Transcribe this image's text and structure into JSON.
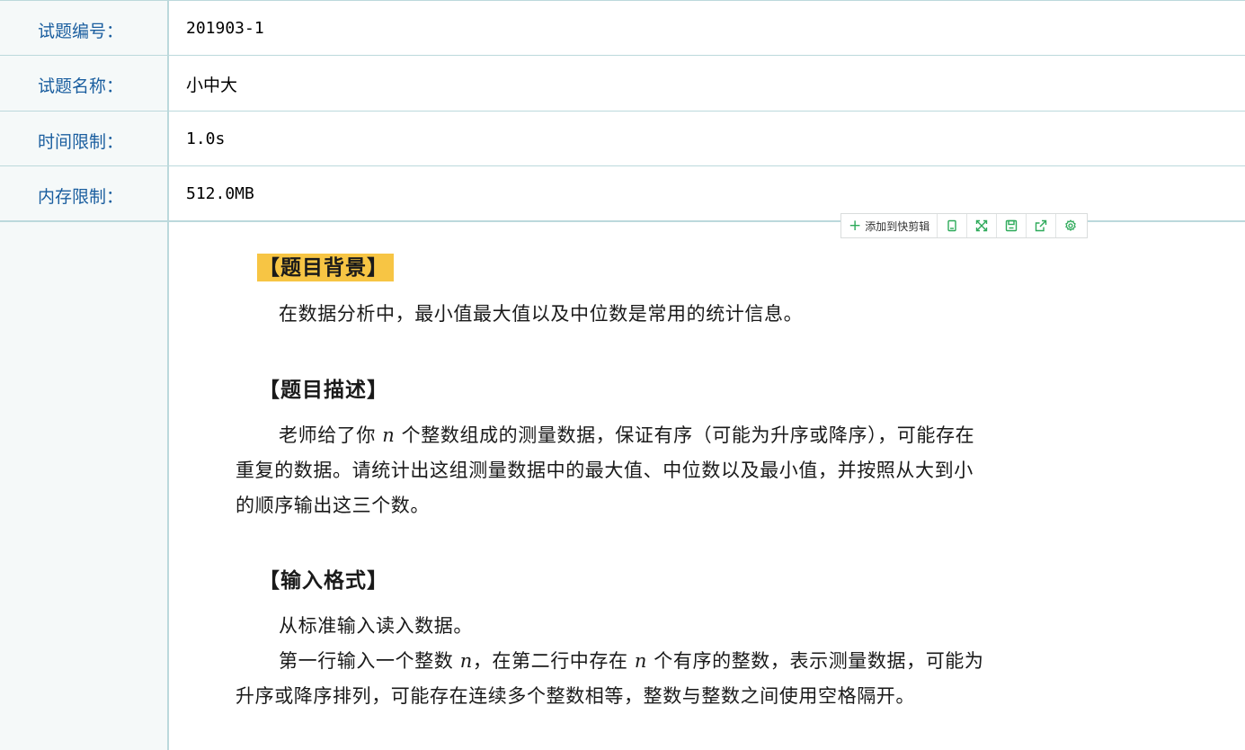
{
  "rows": {
    "id": {
      "label": "试题编号：",
      "value": "201903-1"
    },
    "name": {
      "label": "试题名称：",
      "value": "小中大"
    },
    "time": {
      "label": "时间限制：",
      "value": "1.0s"
    },
    "memory": {
      "label": "内存限制：",
      "value": "512.0MB"
    }
  },
  "toolbar": {
    "add_label": "添加到快剪辑",
    "icons": [
      "copy-icon",
      "expand-icon",
      "save-icon",
      "share-icon",
      "settings-icon"
    ],
    "accent_color": "#2eaa5a"
  },
  "problem": {
    "background_title": "【题目背景】",
    "background_text": "在数据分析中，最小值最大值以及中位数是常用的统计信息。",
    "description_title": "【题目描述】",
    "description_line1_a": "老师给了你 ",
    "description_var": "n",
    "description_line1_b": " 个整数组成的测量数据，保证有序（可能为升序或降序），可能存在",
    "description_line2": "重复的数据。请统计出这组测量数据中的最大值、中位数以及最小值，并按照从大到小",
    "description_line3": "的顺序输出这三个数。",
    "input_title": "【输入格式】",
    "input_line1": "从标准输入读入数据。",
    "input_line2_a": "第一行输入一个整数 ",
    "input_line2_var1": "n",
    "input_line2_b": "，在第二行中存在 ",
    "input_line2_var2": "n",
    "input_line2_c": " 个有序的整数，表示测量数据，可能为",
    "input_line3": "升序或降序排列，可能存在连续多个整数相等，整数与整数之间使用空格隔开。"
  },
  "colors": {
    "label_text": "#1a5e9f",
    "border": "#bcd9dc",
    "label_bg": "#f5f9f9",
    "highlight": "#f7c544"
  }
}
